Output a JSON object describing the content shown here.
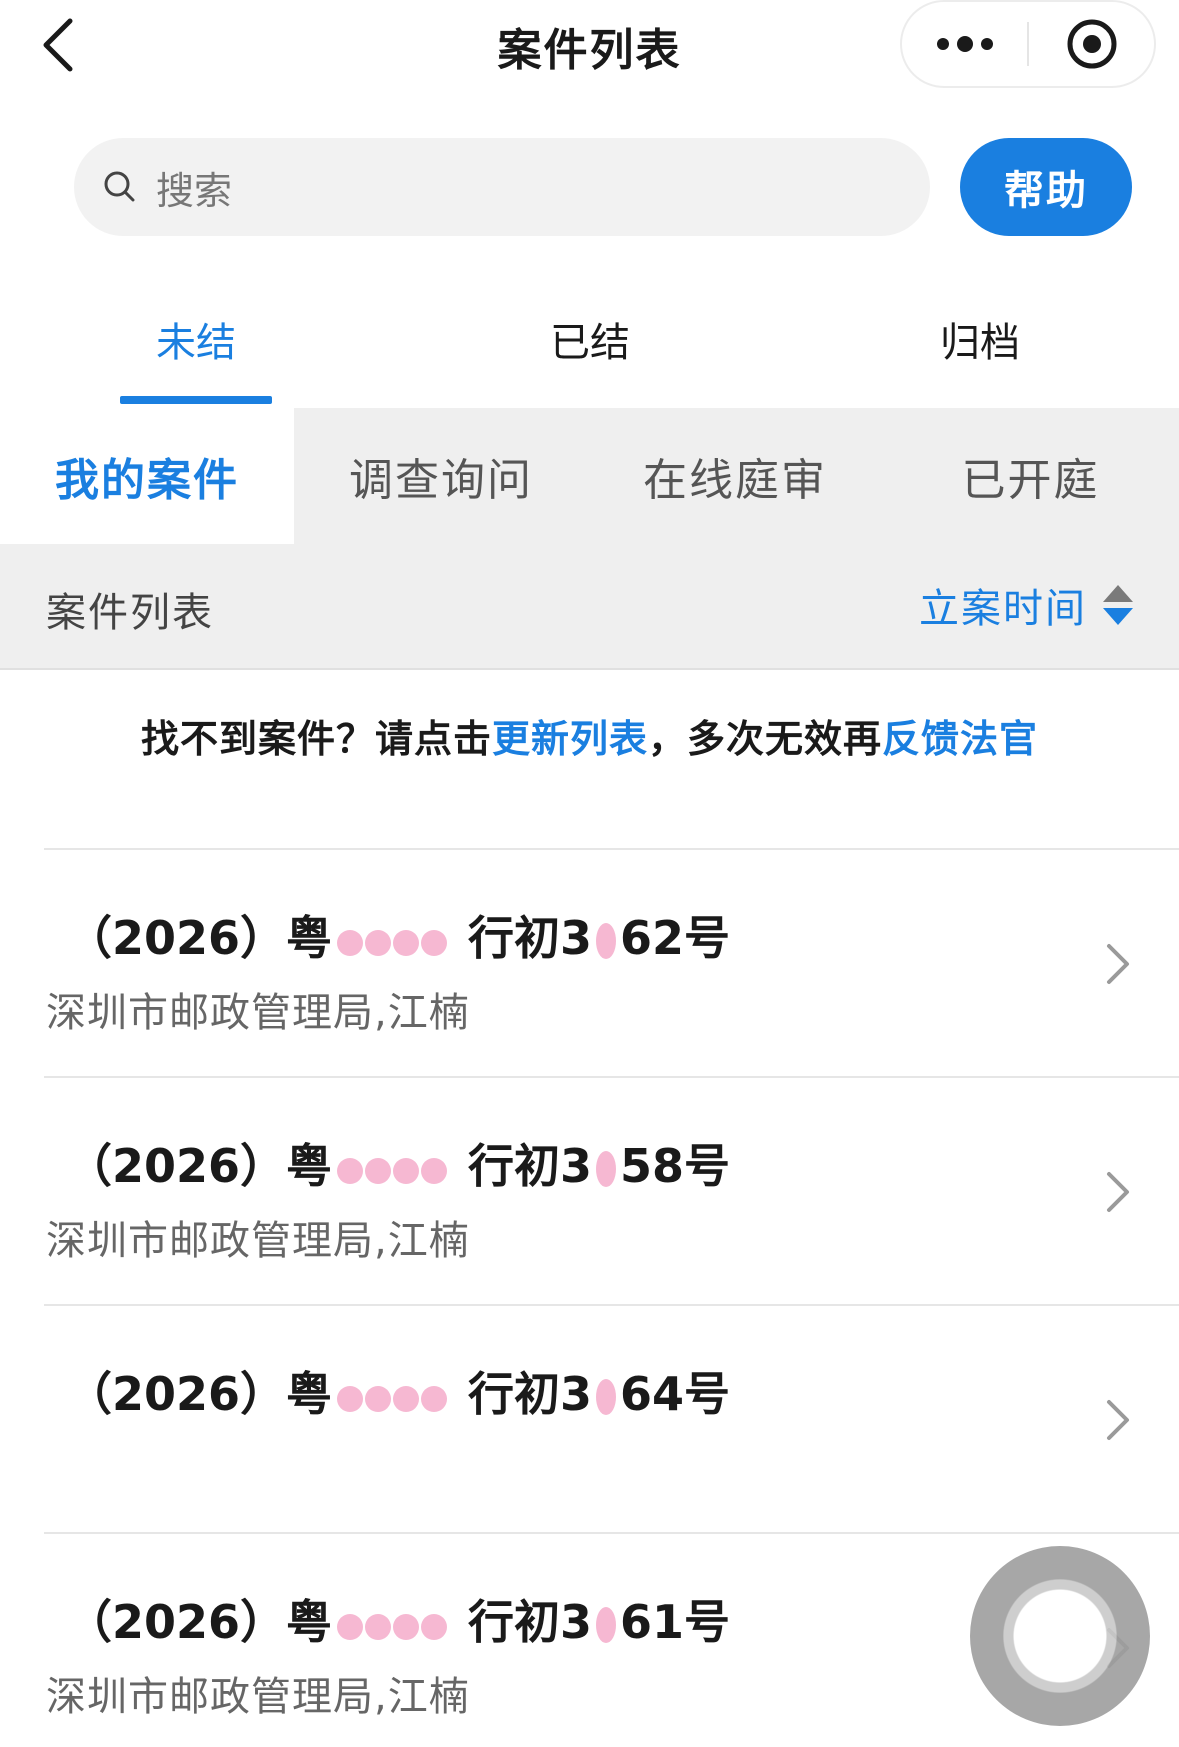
{
  "header": {
    "title": "案件列表",
    "back_icon": "chevron-left-icon",
    "more_icon": "more-dots-icon",
    "close_icon": "record-circle-icon"
  },
  "search": {
    "label": "搜索",
    "icon": "search-icon"
  },
  "help_button": {
    "label": "帮助"
  },
  "status_tabs": [
    {
      "label": "未结",
      "active": true
    },
    {
      "label": "已结",
      "active": false
    },
    {
      "label": "归档",
      "active": false
    }
  ],
  "category_tabs": [
    {
      "label": "我的案件",
      "active": true
    },
    {
      "label": "调查询问",
      "active": false
    },
    {
      "label": "在线庭审",
      "active": false
    },
    {
      "label": "已开庭",
      "active": false
    }
  ],
  "list_header": {
    "title": "案件列表",
    "sort_label": "立案时间",
    "sort_icon": "sort-updown-icon"
  },
  "notice": {
    "prefix": "找不到案件？请点击",
    "link1": "更新列表",
    "middle": "，多次无效再",
    "link2": "反馈法官"
  },
  "cases": [
    {
      "no_prefix": "（2026）粤",
      "no_mid": "行初3",
      "no_suffix": "62号",
      "party": "深圳市邮政管理局,江楠"
    },
    {
      "no_prefix": "（2026）粤",
      "no_mid": "行初3",
      "no_suffix": "58号",
      "party": "深圳市邮政管理局,江楠"
    },
    {
      "no_prefix": "（2026）粤",
      "no_mid": "行初3",
      "no_suffix": "64号",
      "party": ""
    },
    {
      "no_prefix": "（2026）粤",
      "no_mid": "行初3",
      "no_suffix": "61号",
      "party": "深圳市邮政管理局,江楠"
    }
  ],
  "colors": {
    "accent": "#1a7fe0",
    "redaction": "#f6b8d2"
  }
}
